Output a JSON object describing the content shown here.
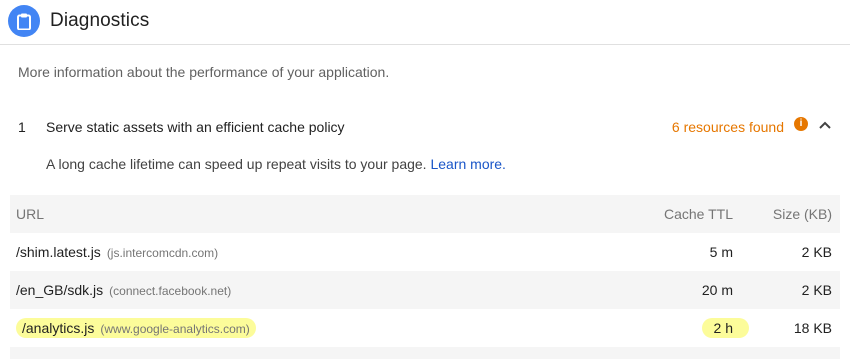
{
  "header": {
    "title": "Diagnostics",
    "icon": "clipboard-icon",
    "icon_color": "#4285f4"
  },
  "description": "More information about the performance of your application.",
  "audit": {
    "index": "1",
    "title": "Serve static assets with an efficient cache policy",
    "summary": "6 resources found",
    "summary_color": "#e67700",
    "description": "A long cache lifetime can speed up repeat visits to your page.",
    "learn_more": "Learn more."
  },
  "table": {
    "columns": {
      "url": "URL",
      "ttl": "Cache TTL",
      "size": "Size (KB)"
    },
    "rows": [
      {
        "path": "/shim.latest.js",
        "host": "(js.intercomcdn.com)",
        "ttl": "5 m",
        "size": "2 KB",
        "highlighted": false
      },
      {
        "path": "/en_GB/sdk.js",
        "host": "(connect.facebook.net)",
        "ttl": "20 m",
        "size": "2 KB",
        "highlighted": false
      },
      {
        "path": "/analytics.js",
        "host": "(www.google-analytics.com)",
        "ttl": "2 h",
        "size": "18 KB",
        "highlighted": true
      }
    ]
  }
}
